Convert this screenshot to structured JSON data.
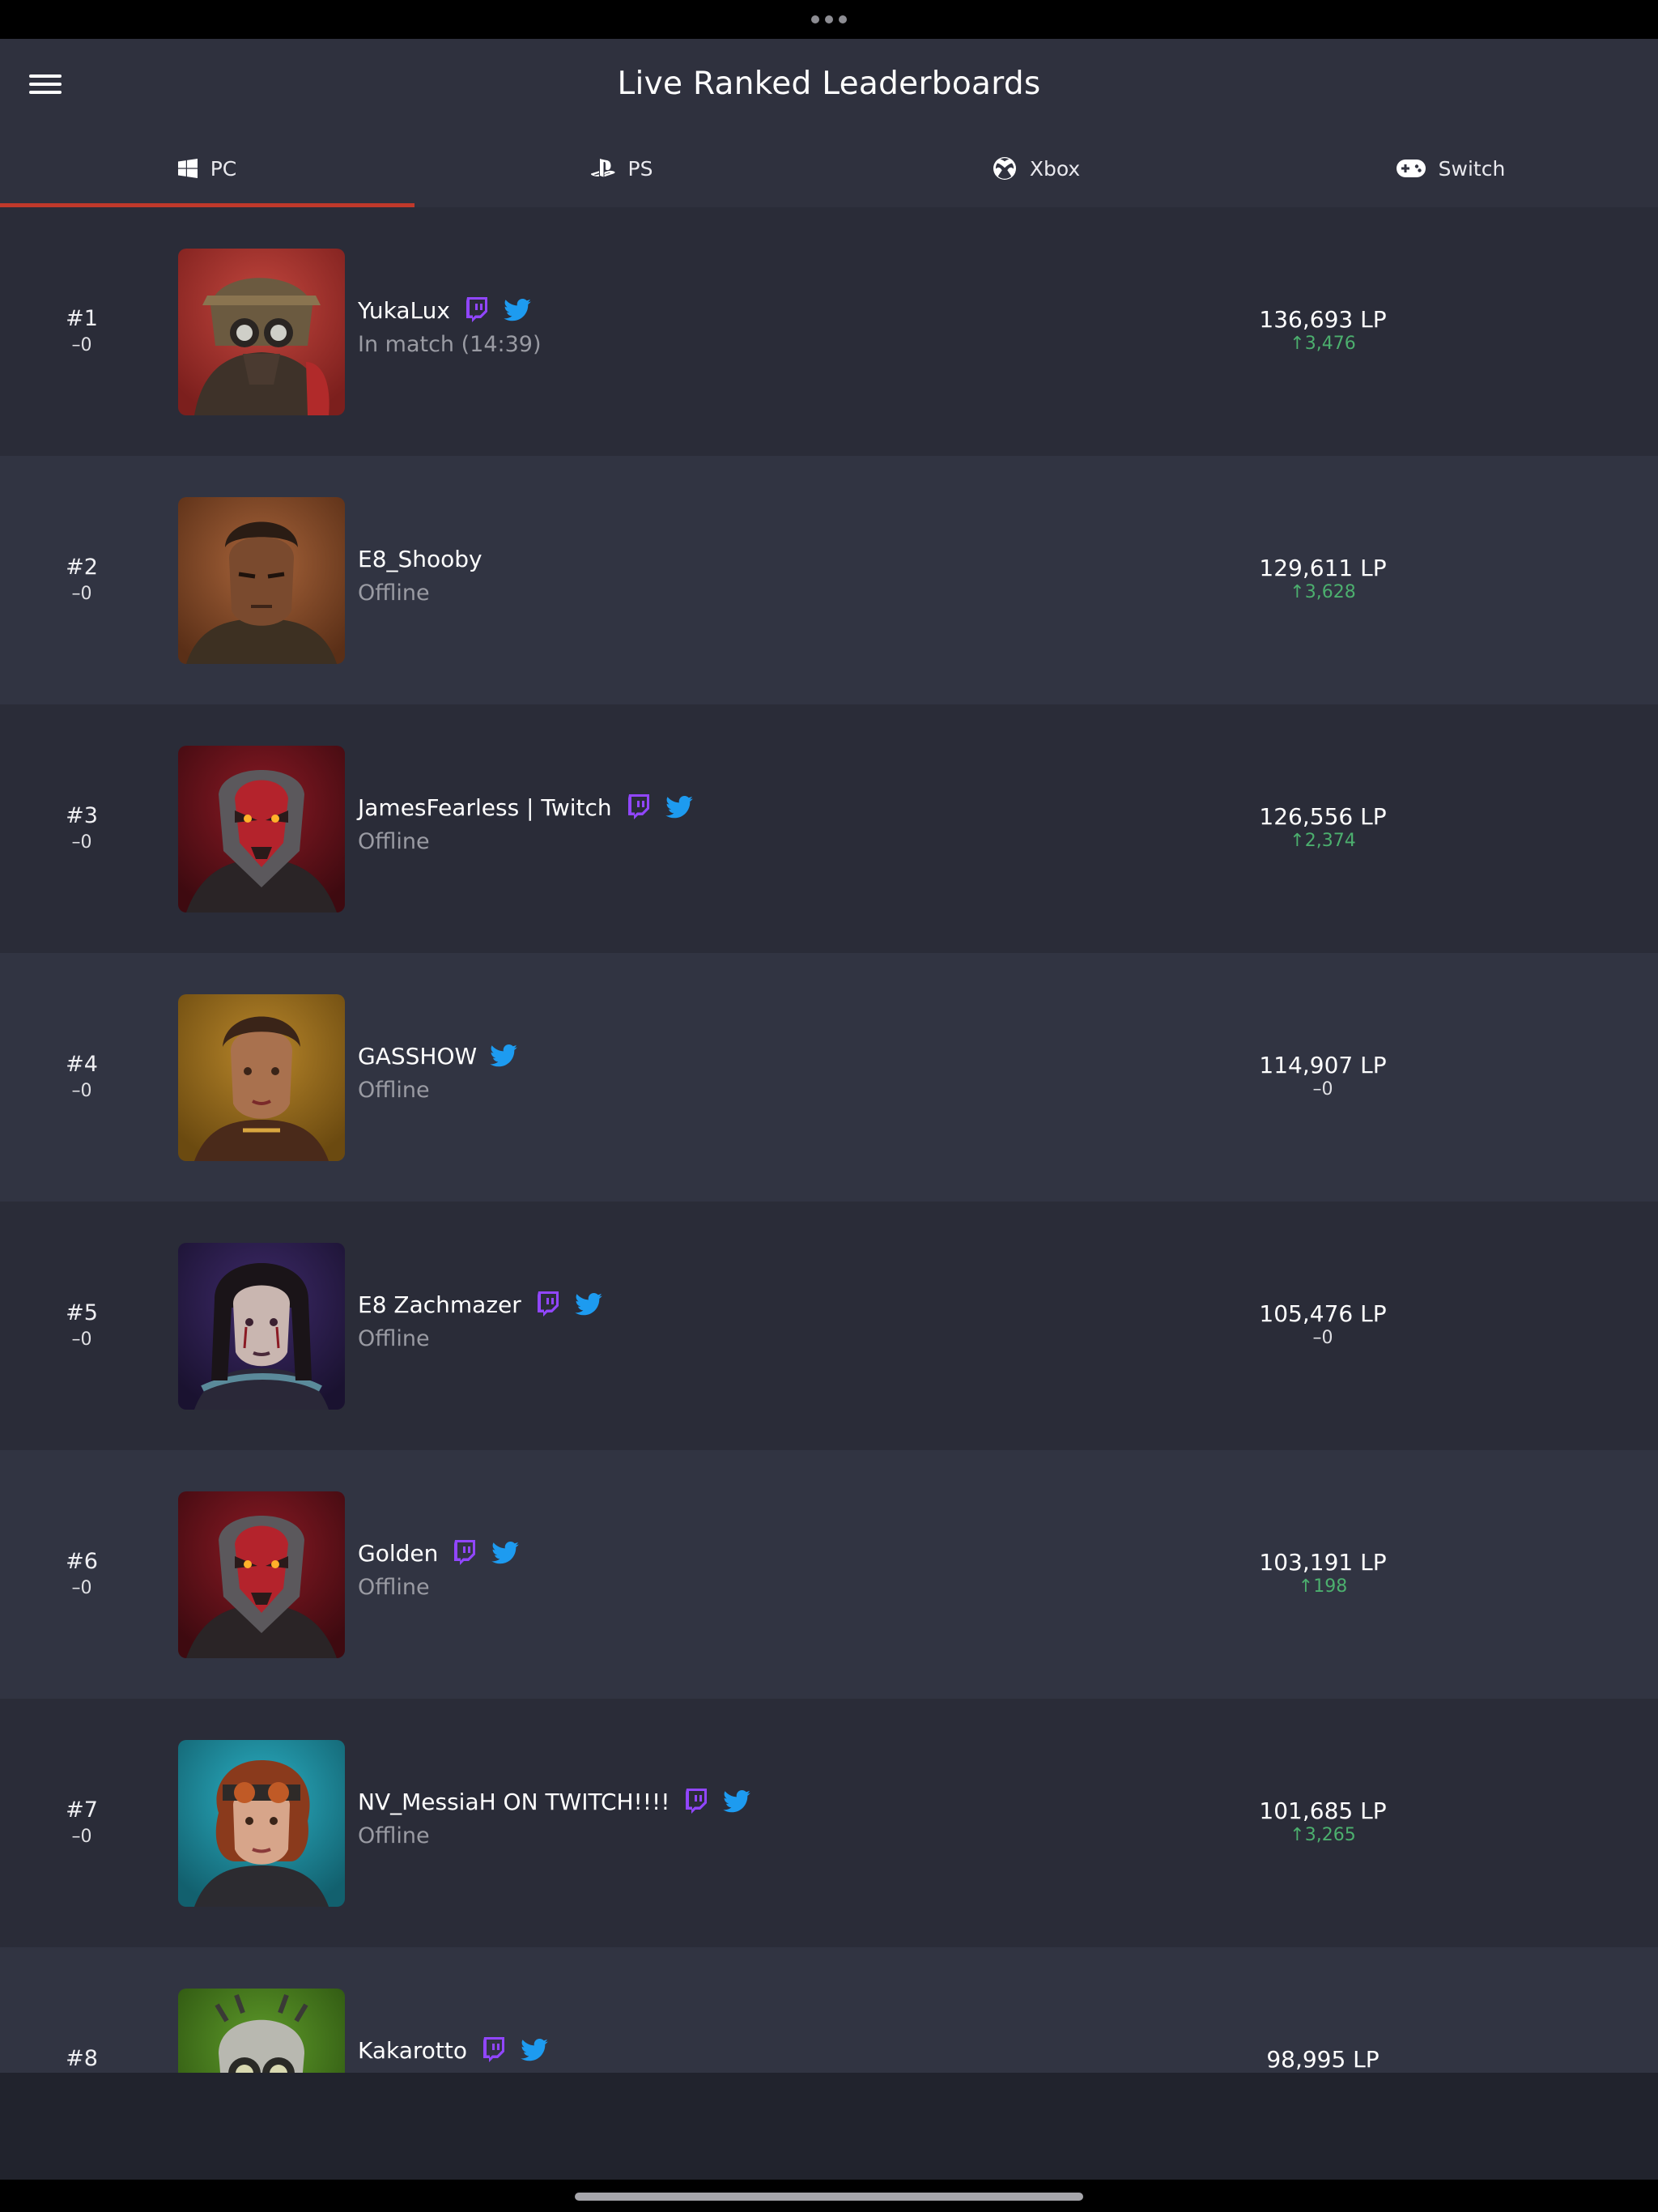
{
  "header": {
    "title": "Live Ranked Leaderboards",
    "menu_icon": "hamburger-menu-icon"
  },
  "tabs": [
    {
      "label": "PC",
      "icon": "windows-icon",
      "selected": true
    },
    {
      "label": "PS",
      "icon": "playstation-icon",
      "selected": false
    },
    {
      "label": "Xbox",
      "icon": "xbox-icon",
      "selected": false
    },
    {
      "label": "Switch",
      "icon": "gamepad-icon",
      "selected": false
    }
  ],
  "colors": {
    "accent": "#c0392b",
    "twitch": "#9146ff",
    "twitter": "#1d9bf0",
    "gain": "#4caf6e",
    "row_dark": "#2a2c38",
    "row_light": "#313442"
  },
  "players": [
    {
      "rank": "#1",
      "rank_change": "–0",
      "name": "YukaLux",
      "status": "In match (14:39)",
      "lp": "136,693 LP",
      "lp_change": "3,476",
      "trend": "up",
      "twitch": true,
      "twitter": true,
      "avatar": "bloodhound-portrait"
    },
    {
      "rank": "#2",
      "rank_change": "–0",
      "name": "E8_Shooby",
      "status": "Offline",
      "lp": "129,611 LP",
      "lp_change": "3,628",
      "trend": "up",
      "twitch": false,
      "twitter": false,
      "avatar": "bangalore-portrait"
    },
    {
      "rank": "#3",
      "rank_change": "–0",
      "name": "JamesFearless | Twitch",
      "status": "Offline",
      "lp": "126,556 LP",
      "lp_change": "2,374",
      "trend": "up",
      "twitch": true,
      "twitter": true,
      "avatar": "revenant-portrait"
    },
    {
      "rank": "#4",
      "rank_change": "–0",
      "name": "GASSHOW",
      "status": "Offline",
      "lp": "114,907 LP",
      "lp_change": "–0",
      "trend": "flat",
      "twitch": false,
      "twitter": true,
      "avatar": "loba-portrait"
    },
    {
      "rank": "#5",
      "rank_change": "–0",
      "name": "E8 Zachmazer",
      "status": "Offline",
      "lp": "105,476 LP",
      "lp_change": "–0",
      "trend": "flat",
      "twitch": true,
      "twitter": true,
      "avatar": "catalyst-portrait"
    },
    {
      "rank": "#6",
      "rank_change": "–0",
      "name": "Golden",
      "status": "Offline",
      "lp": "103,191 LP",
      "lp_change": "198",
      "trend": "up",
      "twitch": true,
      "twitter": true,
      "avatar": "revenant-portrait"
    },
    {
      "rank": "#7",
      "rank_change": "–0",
      "name": "NV_MessiaH ON TWITCH!!!!",
      "status": "Offline",
      "lp": "101,685 LP",
      "lp_change": "3,265",
      "trend": "up",
      "twitch": true,
      "twitter": true,
      "avatar": "horizon-portrait"
    },
    {
      "rank": "#8",
      "rank_change": "",
      "name": "Kakarotto",
      "status": "",
      "lp": "98,995 LP",
      "lp_change": "",
      "trend": "none",
      "twitch": true,
      "twitter": true,
      "avatar": "octane-portrait"
    }
  ]
}
